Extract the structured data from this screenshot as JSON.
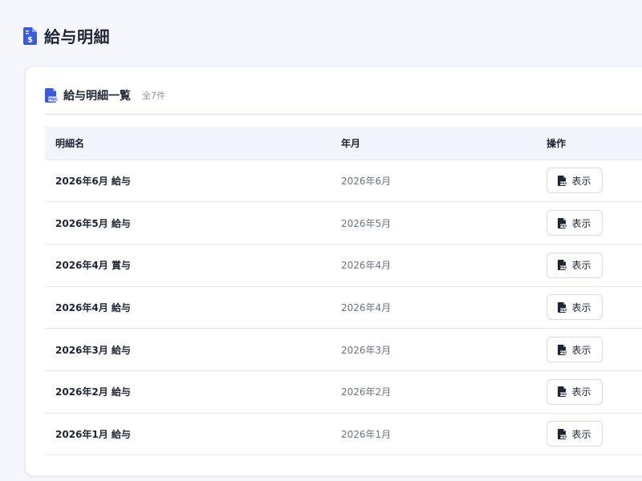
{
  "page": {
    "title": "給与明細",
    "icon": "dollar-document-icon",
    "accent_color": "#3b5bdb"
  },
  "card": {
    "title": "給与明細一覧",
    "icon": "pdf-document-icon",
    "count": "全7件"
  },
  "table": {
    "columns": [
      "明細名",
      "年月",
      "操作"
    ],
    "rows": [
      {
        "name": "2026年6月 給与",
        "period": "2026年6月",
        "action": "表示"
      },
      {
        "name": "2026年5月 給与",
        "period": "2026年5月",
        "action": "表示"
      },
      {
        "name": "2026年4月 賞与",
        "period": "2026年4月",
        "action": "表示"
      },
      {
        "name": "2026年4月 給与",
        "period": "2026年4月",
        "action": "表示"
      },
      {
        "name": "2026年3月 給与",
        "period": "2026年3月",
        "action": "表示"
      },
      {
        "name": "2026年2月 給与",
        "period": "2026年2月",
        "action": "表示"
      },
      {
        "name": "2026年1月 給与",
        "period": "2026年1月",
        "action": "表示"
      }
    ],
    "action_icon": "pdf-file-icon"
  }
}
